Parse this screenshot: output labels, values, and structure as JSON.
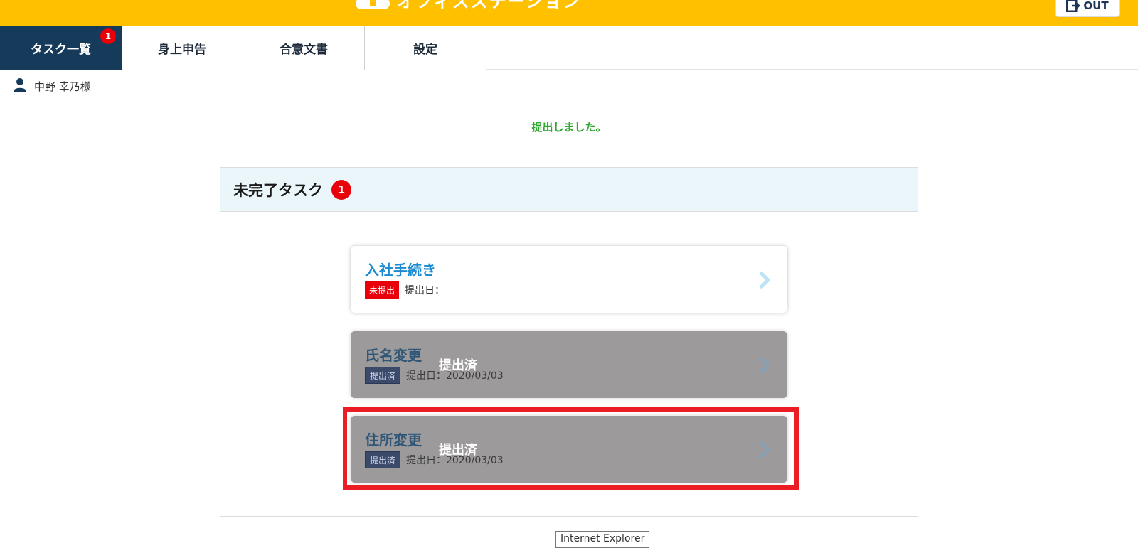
{
  "header": {
    "brand": "オフィスステーション",
    "logout_label": "OUT",
    "colors": {
      "bar": "#ffc000",
      "nav_active": "#163a59",
      "badge": "#e8000b"
    }
  },
  "nav": {
    "tabs": [
      {
        "label": "タスク一覧",
        "badge": "1",
        "active": true
      },
      {
        "label": "身上申告"
      },
      {
        "label": "合意文書"
      },
      {
        "label": "設定"
      }
    ]
  },
  "user": {
    "name": "中野 幸乃様",
    "icon": "person-icon"
  },
  "flash": "提出しました。",
  "panel": {
    "title": "未完了タスク",
    "count": "1",
    "tasks": [
      {
        "title": "入社手続き",
        "status": "未提出",
        "date_text": "提出日：",
        "state": "open"
      },
      {
        "title": "氏名変更",
        "status": "提出済",
        "date_text": "提出日：2020/03/03",
        "overlay": "提出済",
        "state": "done"
      },
      {
        "title": "住所変更",
        "status": "提出済",
        "date_text": "提出日：2020/03/03",
        "overlay": "提出済",
        "state": "done",
        "highlighted": true
      }
    ]
  },
  "tooltip": "Internet Explorer"
}
